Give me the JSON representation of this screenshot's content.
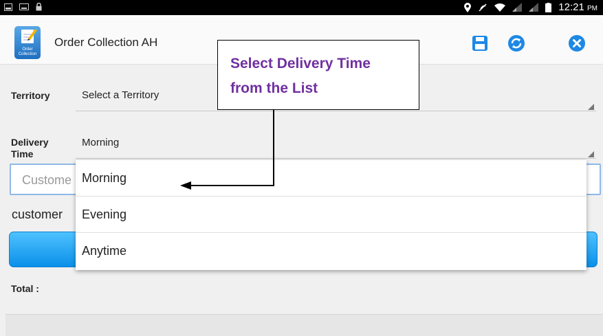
{
  "status_bar": {
    "time": "12:21",
    "ampm": "PM"
  },
  "app": {
    "icon_label": "Order Collection",
    "title": "Order Collection AH"
  },
  "actions": {
    "save": "save-icon",
    "sync": "sync-icon",
    "close": "close-icon"
  },
  "form": {
    "territory_label": "Territory",
    "territory_value": "Select a Territory",
    "delivery_label_1": "Delivery",
    "delivery_label_2": "Time",
    "delivery_value": "Morning",
    "customer_placeholder": "Custome",
    "customer_text": "customer",
    "total_label": "Total :"
  },
  "dropdown": {
    "options": [
      "Morning",
      "Evening",
      "Anytime"
    ]
  },
  "annotation": {
    "line1": "Select Delivery Time",
    "line2": "from the List"
  },
  "colors": {
    "accent_blue": "#1e88e5",
    "annotation_purple": "#7030a0"
  }
}
